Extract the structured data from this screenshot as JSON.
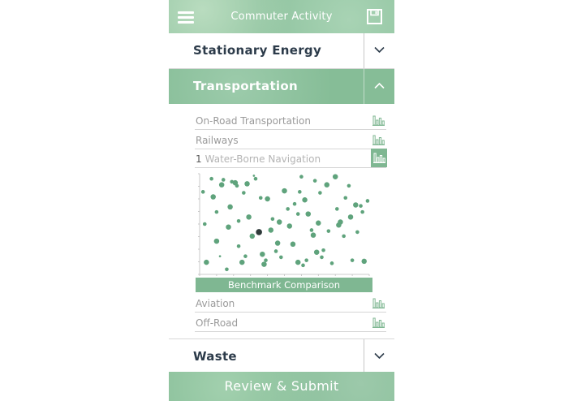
{
  "header": {
    "title": "Commuter Activity",
    "menu_icon": "hamburger-icon",
    "save_icon": "floppy-save-icon"
  },
  "sections": {
    "stationary": {
      "label": "Stationary Energy",
      "state": "collapsed"
    },
    "transportation": {
      "label": "Transportation",
      "state": "expanded"
    },
    "waste": {
      "label": "Waste",
      "state": "collapsed"
    }
  },
  "transport_items": [
    {
      "label": "On-Road Transportation"
    },
    {
      "label": "Railways"
    },
    {
      "value": "1",
      "placeholder": "Water-Borne Navigation"
    },
    {
      "label": "Aviation"
    },
    {
      "label": "Off-Road"
    }
  ],
  "benchmark": {
    "label": "Benchmark Comparison"
  },
  "submit": {
    "label": "Review & Submit"
  },
  "colors": {
    "accent": "#86bd97",
    "point": "#5fa37c",
    "highlight": "#2f3a3a",
    "text_dark": "#2c3b4a"
  },
  "chart_data": {
    "type": "scatter",
    "xlim": [
      0,
      100
    ],
    "ylim": [
      0,
      100
    ],
    "points": [
      [
        2,
        82
      ],
      [
        3,
        50
      ],
      [
        4,
        12
      ],
      [
        7,
        95
      ],
      [
        8,
        77
      ],
      [
        10,
        33
      ],
      [
        10,
        62
      ],
      [
        12,
        18
      ],
      [
        13,
        89
      ],
      [
        14,
        94
      ],
      [
        16,
        5
      ],
      [
        17,
        47
      ],
      [
        18,
        67
      ],
      [
        19,
        92
      ],
      [
        21,
        91
      ],
      [
        22,
        88
      ],
      [
        23,
        53
      ],
      [
        23,
        28
      ],
      [
        25,
        12
      ],
      [
        26,
        81
      ],
      [
        27,
        18
      ],
      [
        28,
        90
      ],
      [
        29,
        57
      ],
      [
        31,
        38
      ],
      [
        32,
        98
      ],
      [
        33,
        95
      ],
      [
        35,
        42
      ],
      [
        36,
        76
      ],
      [
        37,
        20
      ],
      [
        38,
        10
      ],
      [
        39,
        14
      ],
      [
        40,
        75
      ],
      [
        42,
        44
      ],
      [
        43,
        55
      ],
      [
        45,
        23
      ],
      [
        46,
        31
      ],
      [
        47,
        52
      ],
      [
        48,
        17
      ],
      [
        50,
        83
      ],
      [
        52,
        65
      ],
      [
        53,
        48
      ],
      [
        55,
        30
      ],
      [
        56,
        70
      ],
      [
        58,
        12
      ],
      [
        58,
        60
      ],
      [
        59,
        82
      ],
      [
        60,
        97
      ],
      [
        61,
        9
      ],
      [
        62,
        74
      ],
      [
        63,
        14
      ],
      [
        64,
        60
      ],
      [
        66,
        44
      ],
      [
        67,
        39
      ],
      [
        68,
        93
      ],
      [
        69,
        22
      ],
      [
        70,
        51
      ],
      [
        71,
        81
      ],
      [
        72,
        17
      ],
      [
        73,
        24
      ],
      [
        75,
        89
      ],
      [
        76,
        43
      ],
      [
        78,
        11
      ],
      [
        80,
        97
      ],
      [
        81,
        65
      ],
      [
        82,
        49
      ],
      [
        83,
        52
      ],
      [
        85,
        38
      ],
      [
        86,
        76
      ],
      [
        88,
        88
      ],
      [
        89,
        57
      ],
      [
        90,
        14
      ],
      [
        92,
        69
      ],
      [
        93,
        42
      ],
      [
        95,
        68
      ],
      [
        96,
        62
      ],
      [
        97,
        13
      ],
      [
        99,
        73
      ]
    ],
    "sizes": [
      2,
      2,
      3,
      2,
      3,
      3,
      2,
      1,
      3,
      2,
      2,
      3,
      3,
      2,
      3,
      2,
      2,
      2,
      3,
      2,
      2,
      3,
      3,
      3,
      1,
      2,
      3,
      2,
      3,
      3,
      2,
      3,
      3,
      2,
      2,
      3,
      3,
      2,
      3,
      2,
      3,
      3,
      2,
      3,
      2,
      2,
      2,
      2,
      3,
      2,
      3,
      2,
      3,
      2,
      3,
      3,
      2,
      2,
      2,
      3,
      2,
      2,
      3,
      2,
      3,
      3,
      2,
      2,
      2,
      3,
      2,
      3,
      2,
      2,
      2,
      3,
      2
    ],
    "highlight_index": 26
  }
}
